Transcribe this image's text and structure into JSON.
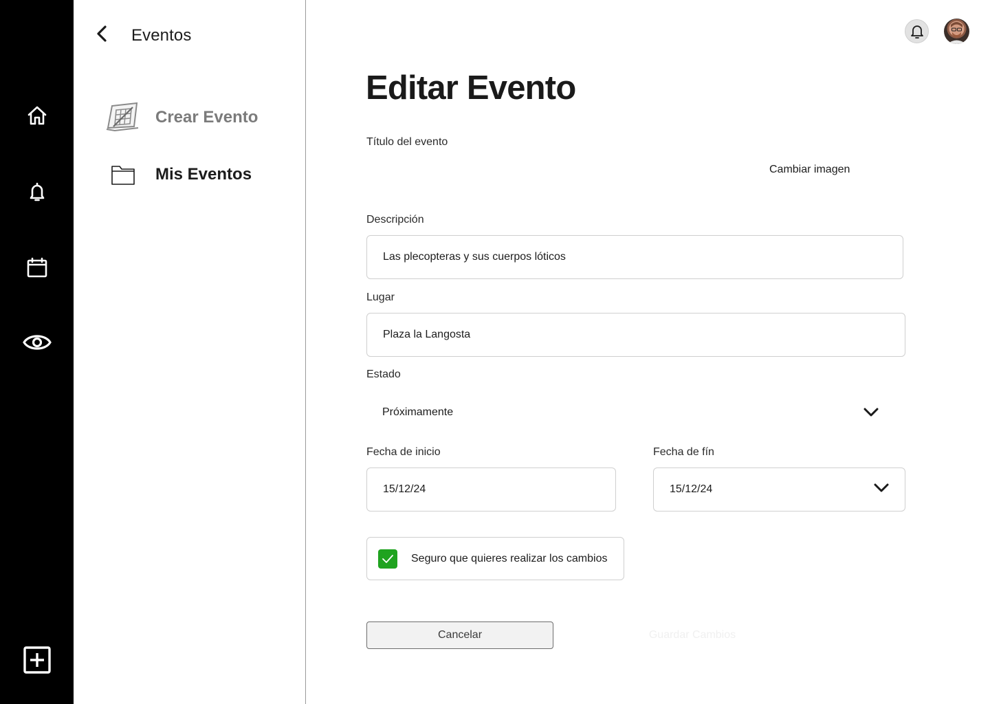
{
  "rail": {
    "items": [
      {
        "name": "home",
        "icon": "home-icon"
      },
      {
        "name": "notifications",
        "icon": "bell-icon"
      },
      {
        "name": "calendar",
        "icon": "calendar-icon"
      },
      {
        "name": "view",
        "icon": "eye-icon"
      },
      {
        "name": "add",
        "icon": "plus-square-icon"
      }
    ]
  },
  "sidebar": {
    "title": "Eventos",
    "back_icon": "chevron-left-icon",
    "items": [
      {
        "label": "Crear Evento",
        "icon": "create-event-icon",
        "state": "muted"
      },
      {
        "label": "Mis Eventos",
        "icon": "folder-icon",
        "state": "active"
      }
    ]
  },
  "header": {
    "bell_icon": "bell-icon",
    "avatar_icon": "user-avatar"
  },
  "form": {
    "page_title": "Editar Evento",
    "title_label": "Título del evento",
    "change_image_label": "Cambiar imagen",
    "description_label": "Descripción",
    "description_value": "Las plecopteras y sus cuerpos lóticos",
    "place_label": "Lugar",
    "place_value": "Plaza la Langosta",
    "status_label": "Estado",
    "status_value": "Próximamente",
    "start_date_label": "Fecha de inicio",
    "start_date_value": "15/12/24",
    "end_date_label": "Fecha de fín",
    "end_date_value": "15/12/24",
    "confirm_label": "Seguro que quieres realizar los cambios",
    "confirm_checked": true,
    "cancel_label": "Cancelar",
    "save_label": "Guardar Cambios"
  },
  "colors": {
    "rail_bg": "#000000",
    "checkbox": "#1fa31f",
    "muted_text": "#7b7b7b"
  }
}
